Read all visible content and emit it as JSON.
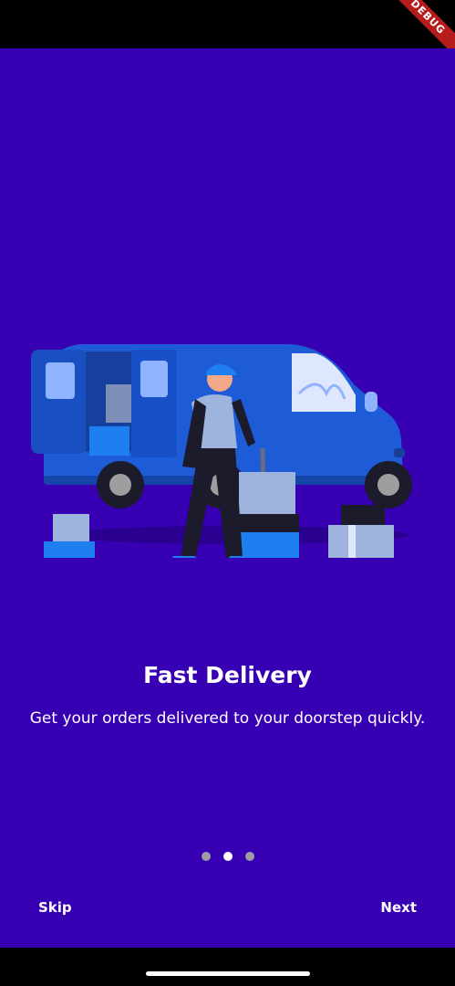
{
  "debug_banner": "DEBUG",
  "onboarding": {
    "title": "Fast Delivery",
    "subtitle": "Get your orders delivered to your doorstep quickly.",
    "illustration": "delivery-van-courier",
    "page_indicator": {
      "current": 2,
      "total": 3
    },
    "skip_label": "Skip",
    "next_label": "Next"
  },
  "colors": {
    "background": "#3700b3",
    "van": "#1e5bd6",
    "dot_active": "#ffffff",
    "dot_inactive": "#9e9e9e"
  }
}
